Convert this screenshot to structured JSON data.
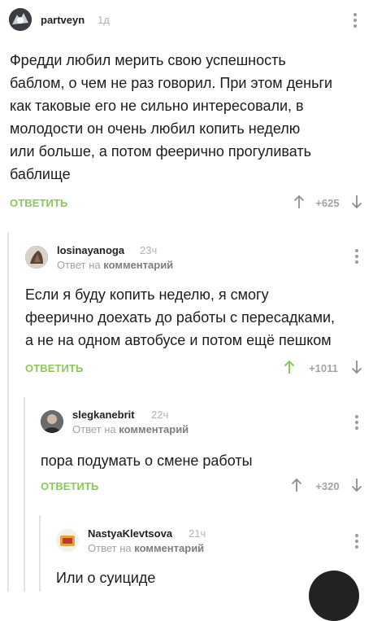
{
  "comments": [
    {
      "username": "partveyn",
      "time": "1д",
      "reply_to_prefix": "",
      "reply_to_link": "",
      "text_lines": [
        "Фредди любил мерить свою успешность",
        "баблом, о чем не раз говорил. При этом деньги",
        "как таковые его не сильно интересовали, в",
        "молодости он очень любил копить неделю",
        "или больше, а потом феерично прогуливать",
        "баблище"
      ],
      "reply_label": "ОТВЕТИТЬ",
      "rating": "+625",
      "upvote_active": false,
      "avatar_icon": "user-avatar-icon"
    },
    {
      "username": "losinayanoga",
      "time": "23ч",
      "reply_to_prefix": "Ответ на",
      "reply_to_link": "комментарий",
      "text_lines": [
        "Если я буду копить неделю, я смогу",
        "феерично доехать до работы с пересадками,",
        "а не на одном автобусе и потом ещё пешком"
      ],
      "reply_label": "ОТВЕТИТЬ",
      "rating": "+1011",
      "upvote_active": true,
      "avatar_icon": "user-avatar-icon"
    },
    {
      "username": "slegkanebrit",
      "time": "22ч",
      "reply_to_prefix": "Ответ на",
      "reply_to_link": "комментарий",
      "text_lines": [
        "пора подумать о смене работы"
      ],
      "reply_label": "ОТВЕТИТЬ",
      "rating": "+320",
      "upvote_active": false,
      "avatar_icon": "user-avatar-icon"
    },
    {
      "username": "NastyaKlevtsova",
      "time": "21ч",
      "reply_to_prefix": "Ответ на",
      "reply_to_link": "комментарий",
      "text_lines": [
        "Или о суициде"
      ],
      "avatar_icon": "user-avatar-icon"
    }
  ],
  "colors": {
    "accent_green": "#8ac858",
    "muted_gray": "#a3a3a3",
    "text": "#1c1c1c"
  },
  "icons": {
    "more": "more-vertical-icon",
    "upvote": "arrow-up-icon",
    "downvote": "arrow-down-icon",
    "fab": "floating-action-button"
  }
}
